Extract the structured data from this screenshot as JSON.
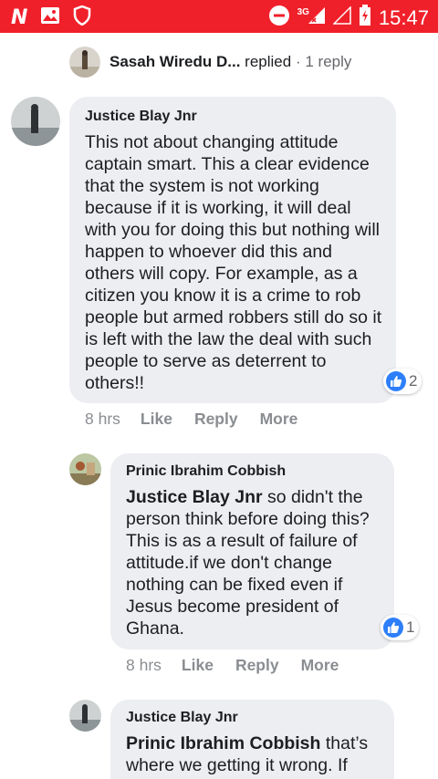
{
  "status_bar": {
    "network": "3G",
    "time": "15:47"
  },
  "reply_summary": {
    "name": "Sasah Wiredu D...",
    "action": "replied",
    "separator": "·",
    "count": "1 reply"
  },
  "comments": [
    {
      "author": "Justice Blay Jnr",
      "mention": "",
      "text": "This not about changing attitude captain smart. This a clear evidence that the system is not working because if it is working, it will deal with you for doing this but nothing will happen to whoever did this and others will copy. For example, as a citizen you know it is a crime to rob people but armed robbers still do so it is left with the law the deal with such people to serve as deterrent to others!!",
      "reactions": "2",
      "time": "8 hrs",
      "like": "Like",
      "reply": "Reply",
      "more": "More"
    },
    {
      "author": "Prinic Ibrahim Cobbish",
      "mention": "Justice Blay Jnr",
      "text": " so didn't the person think before doing this? This is as a result of failure of attitude.if we don't change nothing can be fixed even if Jesus become president of Ghana.",
      "reactions": "1",
      "time": "8 hrs",
      "like": "Like",
      "reply": "Reply",
      "more": "More"
    },
    {
      "author": "Justice Blay Jnr",
      "mention": "Prinic Ibrahim Cobbish",
      "text": " that’s where we getting it wrong. If"
    }
  ],
  "colors": {
    "status_bar": "#f0202a",
    "bubble": "#eceef1",
    "like_blue": "#2d7ff9",
    "muted": "#8a8d91"
  }
}
